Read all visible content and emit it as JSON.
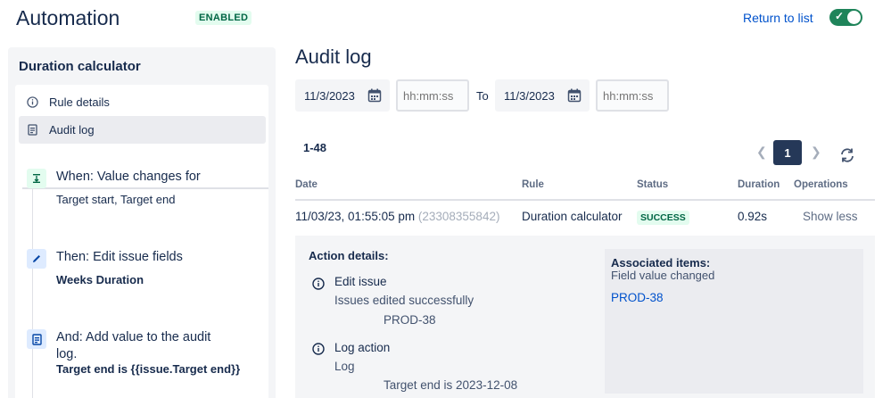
{
  "header": {
    "title": "Automation",
    "status_badge": "ENABLED",
    "return_link": "Return to list",
    "toggle_on": true
  },
  "sidebar": {
    "title": "Duration calculator",
    "nav": [
      {
        "label": "Rule details",
        "icon": "info-icon",
        "active": false
      },
      {
        "label": "Audit log",
        "icon": "document-icon",
        "active": true
      }
    ],
    "steps": [
      {
        "icon": "trigger-icon",
        "heading": "When: Value changes for",
        "desc": "Target start, Target end",
        "desc_bold": false
      },
      {
        "icon": "pencil-icon",
        "heading": "Then: Edit issue fields",
        "desc": "Weeks Duration",
        "desc_bold": true
      },
      {
        "icon": "log-icon",
        "heading": "And: Add value to the audit log.",
        "desc": "Target end is {{issue.Target end}}",
        "desc_bold": true
      }
    ]
  },
  "audit": {
    "title": "Audit log",
    "from_date": "11/3/2023",
    "from_time_placeholder": "hh:mm:ss",
    "to_label": "To",
    "to_date": "11/3/2023",
    "to_time_placeholder": "hh:mm:ss",
    "range": "1-48",
    "current_page": "1",
    "columns": [
      "Date",
      "Rule",
      "Status",
      "Duration",
      "Operations"
    ],
    "row": {
      "date": "11/03/23, 01:55:05 pm",
      "id": "(23308355842)",
      "rule": "Duration calculator",
      "status": "SUCCESS",
      "duration": "0.92s",
      "operation": "Show less"
    },
    "details": {
      "title": "Action details:",
      "actions": [
        {
          "icon": "info-icon",
          "heading": "Edit issue",
          "line": "Issues edited successfully",
          "value": "PROD-38"
        },
        {
          "icon": "info-icon",
          "heading": "Log action",
          "line": "Log",
          "value": "Target end is 2023-12-08"
        }
      ],
      "associated": {
        "title": "Associated items:",
        "subtitle": "Field value changed",
        "link": "PROD-38"
      }
    }
  },
  "colors": {
    "accent": "#0052CC",
    "toggle": "#1F845A",
    "success_bg": "#E3FCEF",
    "success_text": "#006644",
    "page_active": "#253858"
  }
}
